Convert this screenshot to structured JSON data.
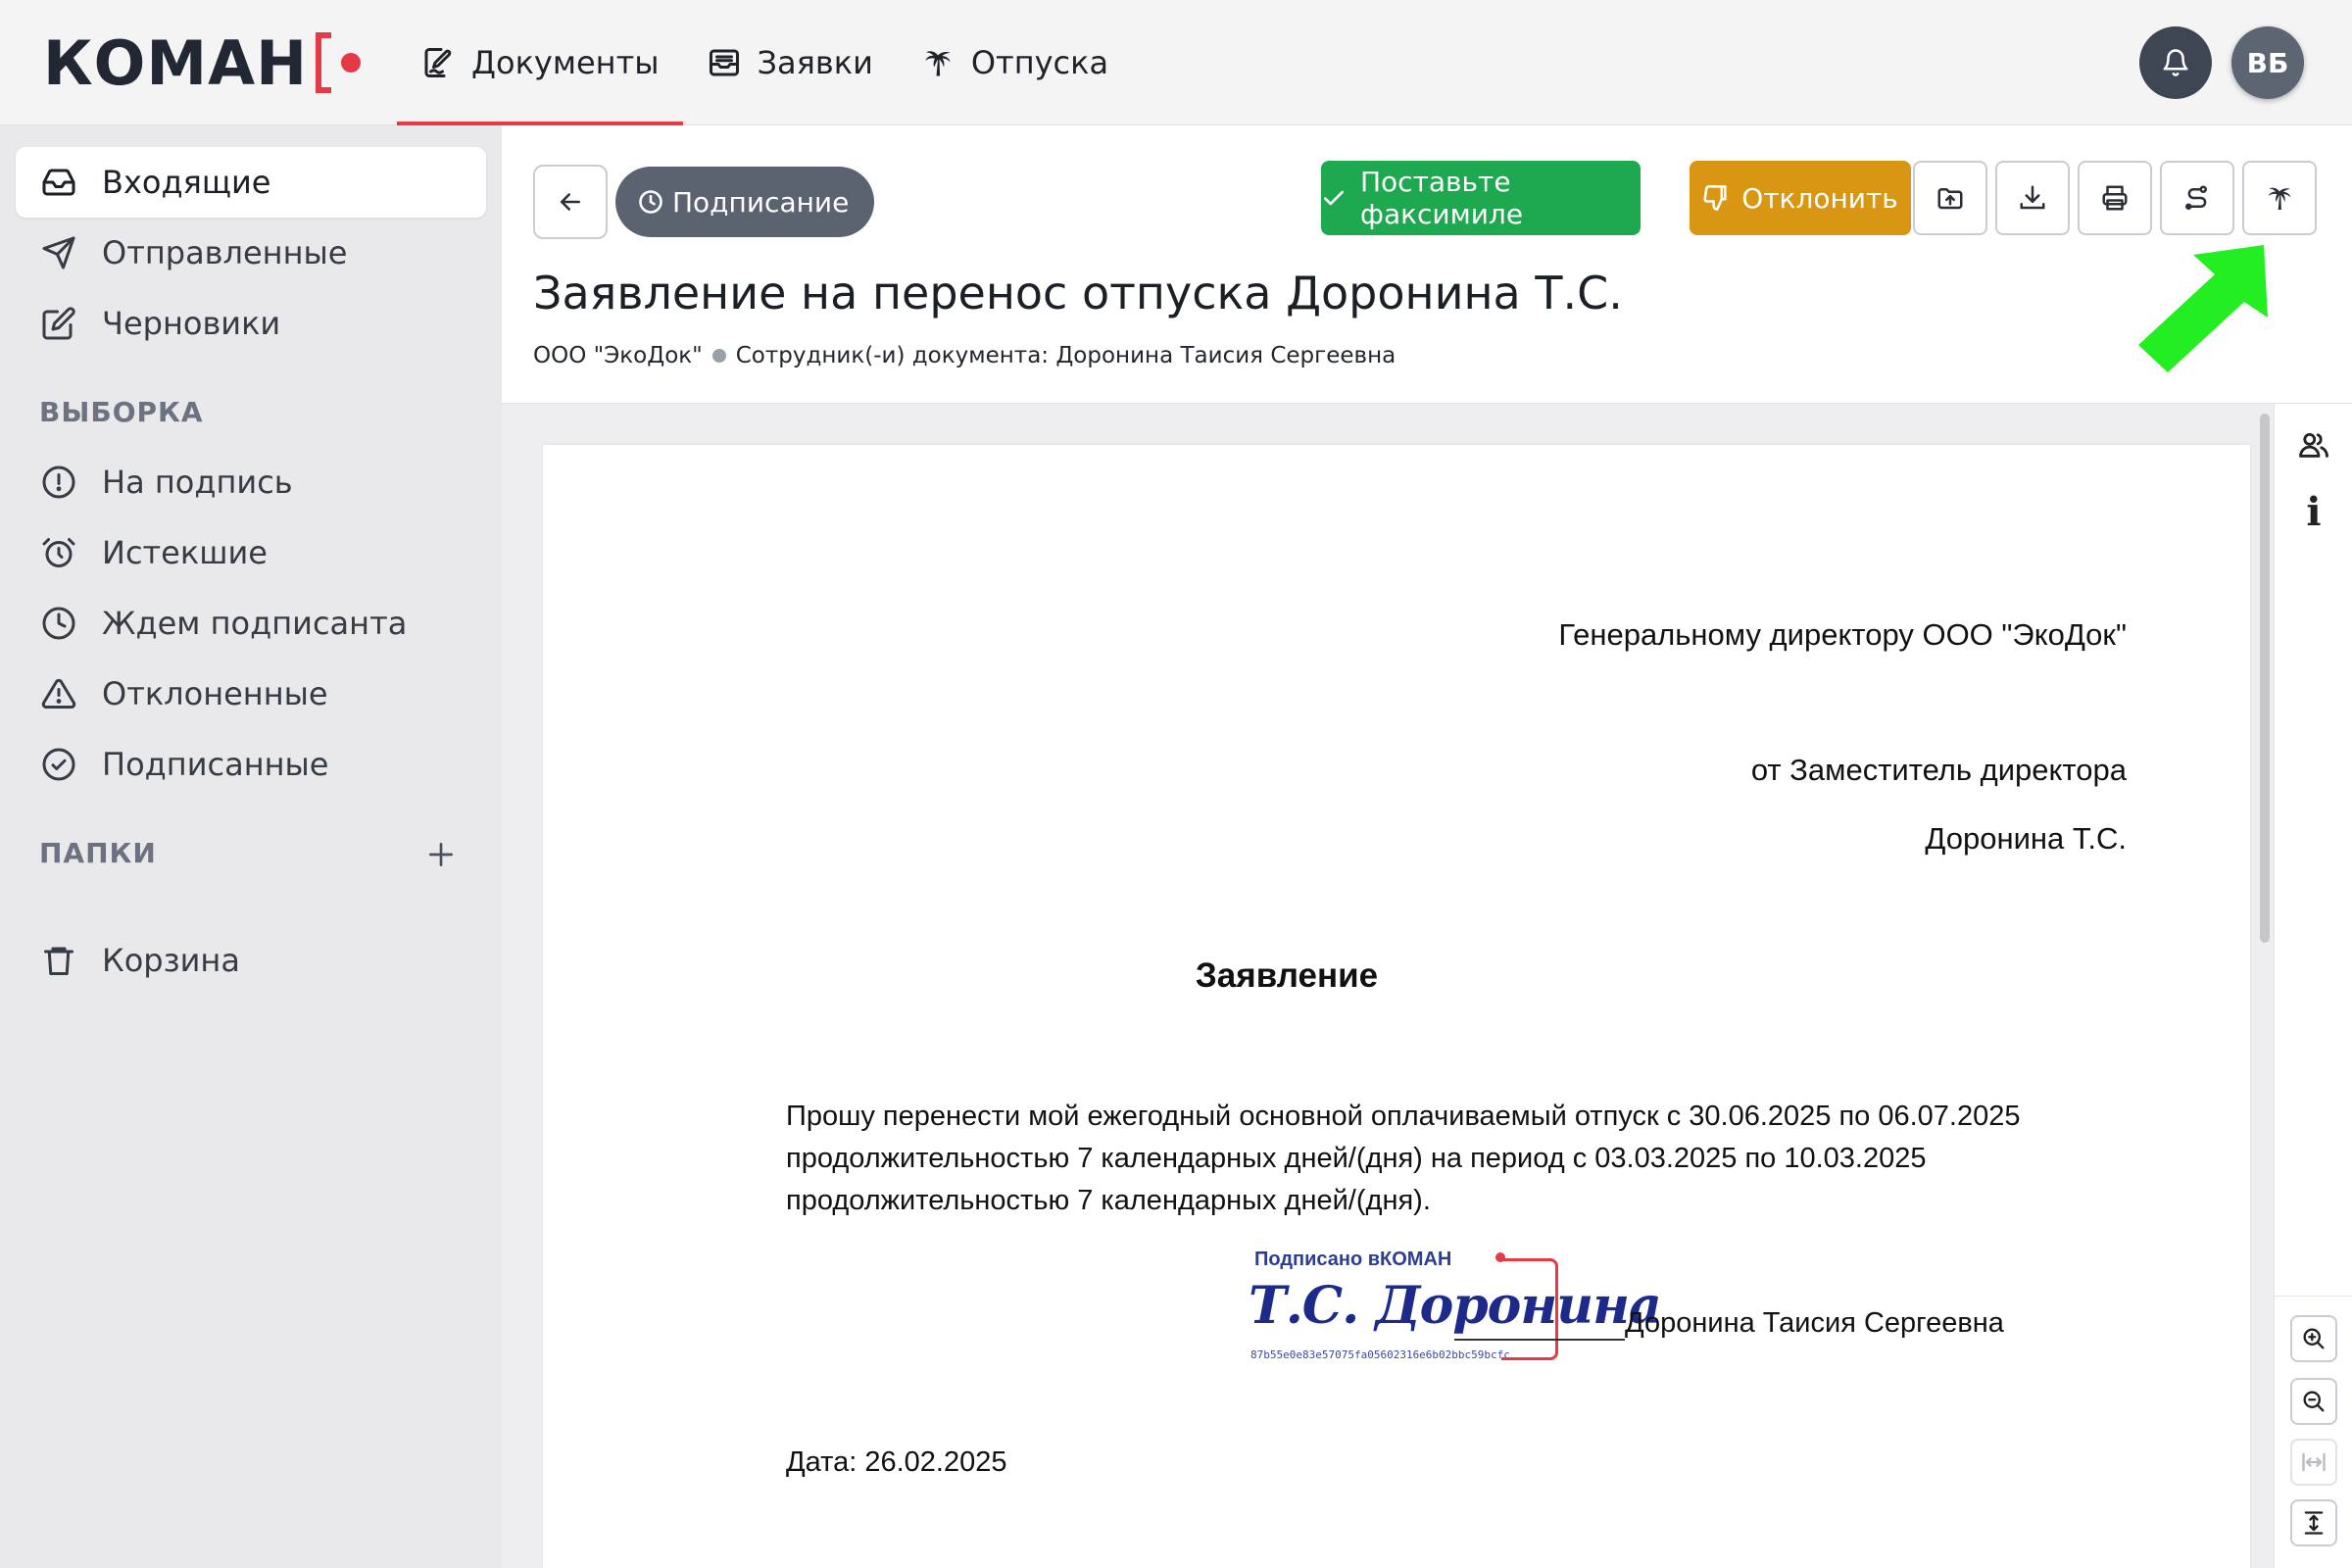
{
  "app": {
    "logo_text": "КОМАН"
  },
  "nav": {
    "items": [
      {
        "label": "Документы",
        "icon": "document-edit-icon",
        "active": true
      },
      {
        "label": "Заявки",
        "icon": "inbox-tray-icon",
        "active": false
      },
      {
        "label": "Отпуска",
        "icon": "palm-tree-icon",
        "active": false
      }
    ]
  },
  "user": {
    "initials": "ВБ",
    "notifications_icon": "bell-icon"
  },
  "sidebar": {
    "main_items": [
      {
        "label": "Входящие",
        "icon": "inbox-icon",
        "active": true
      },
      {
        "label": "Отправленные",
        "icon": "send-icon",
        "active": false
      },
      {
        "label": "Черновики",
        "icon": "pencil-square-icon",
        "active": false
      }
    ],
    "section_filters": "ВЫБОРКА",
    "filter_items": [
      {
        "label": "На подпись",
        "icon": "exclamation-circle-icon"
      },
      {
        "label": "Истекшие",
        "icon": "alarm-clock-icon"
      },
      {
        "label": "Ждем подписанта",
        "icon": "clock-icon"
      },
      {
        "label": "Отклоненные",
        "icon": "warning-triangle-icon"
      },
      {
        "label": "Подписанные",
        "icon": "check-circle-icon"
      }
    ],
    "section_folders": "ПАПКИ",
    "trash_label": "Корзина"
  },
  "document": {
    "status": "Подписание",
    "actions": {
      "facsimile": "Поставьте факсимиле",
      "reject": "Отклонить"
    },
    "toolbar_icons": [
      "upload-folder-icon",
      "download-icon",
      "print-icon",
      "route-icon",
      "palm-tree-icon"
    ],
    "title": "Заявление на перенос отпуска Доронина Т.С.",
    "organization": "ООО \"ЭкоДок\"",
    "employees": "Сотрудник(-и) документа: Доронина Таисия Сергеевна"
  },
  "content": {
    "addressee": "Генеральному директору ООО \"ЭкоДок\"",
    "from_line1": "от Заместитель директора",
    "from_line2": "Доронина Т.С.",
    "heading": "Заявление",
    "body_lines": [
      "Прошу перенести мой ежегодный основной оплачиваемый отпуск с 30.06.2025  по 06.07.2025",
      "продолжительностью 7  календарных дней/(дня) на период с 03.03.2025  по 10.03.2025",
      "продолжительностью 7  календарных дней/(дня)."
    ],
    "signature": {
      "label": "Подписано в",
      "label_brand": "КОМАН",
      "script": "Т.С. Доронина",
      "hash": "87b55e0e83e57075fa05602316e6b02bbc59bcfc"
    },
    "signer_name": "Доронина Таисия Сергеевна",
    "date": "Дата: 26.02.2025"
  },
  "right_rail": {
    "icons": [
      "users-icon",
      "info-icon",
      "zoom-in-icon",
      "zoom-out-icon",
      "fit-width-icon",
      "fit-height-icon"
    ],
    "info_glyph": "i"
  },
  "colors": {
    "accent_red": "#e63946",
    "success_green": "#1ea84f",
    "warning_orange": "#d89612",
    "status_gray": "#5b6270",
    "highlight_arrow": "#22ee22"
  }
}
